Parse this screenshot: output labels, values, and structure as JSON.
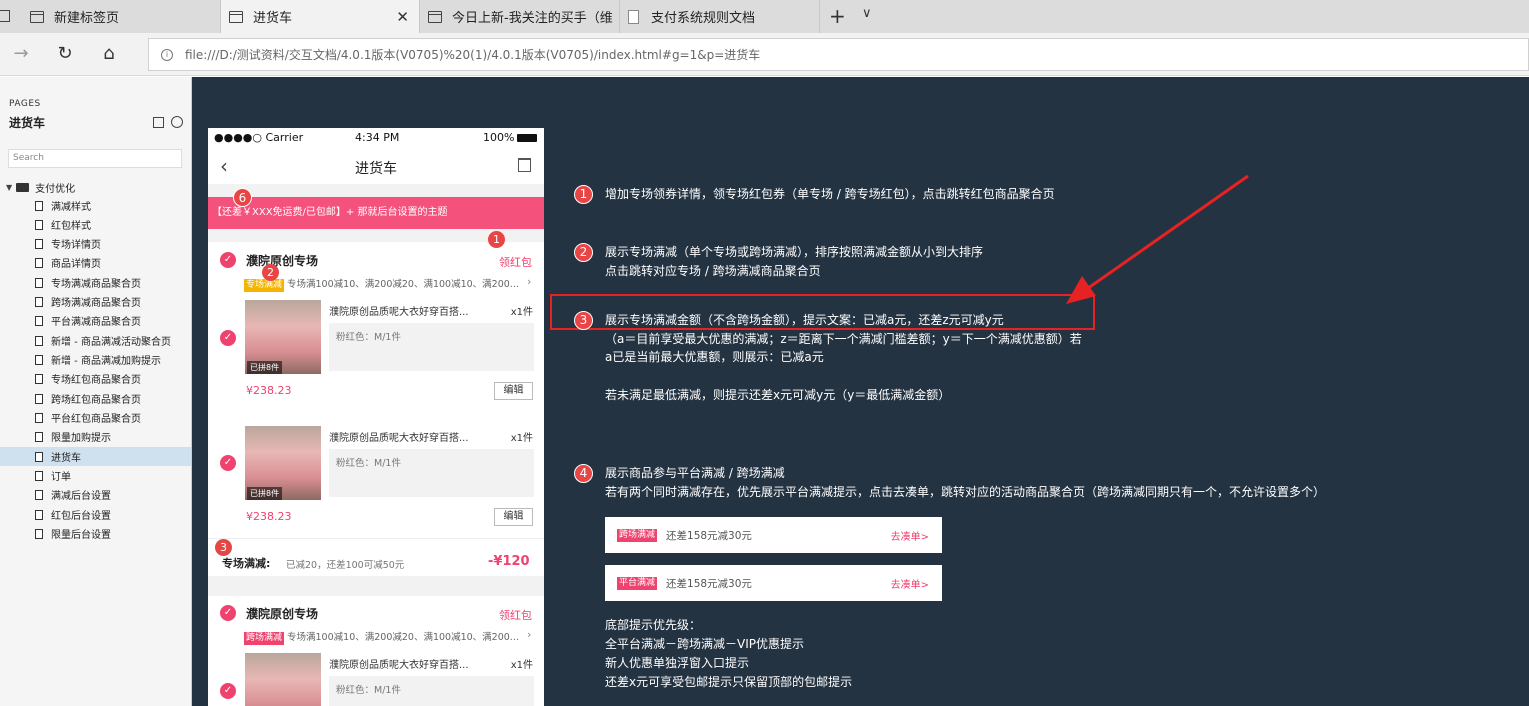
{
  "browser": {
    "tabs": [
      {
        "label": "新建标签页"
      },
      {
        "label": "进货车"
      },
      {
        "label": "今日上新-我关注的买手（维"
      },
      {
        "label": "支付系统规则文档"
      }
    ],
    "url": "file:///D:/测试资料/交互文档/4.0.1版本(V0705)%20(1)/4.0.1版本(V0705)/index.html#g=1&p=进货车"
  },
  "sidebar": {
    "pages_label": "PAGES",
    "current_page": "进货车",
    "search_placeholder": "Search",
    "folder": "支付优化",
    "items": [
      {
        "label": "满减样式"
      },
      {
        "label": "红包样式"
      },
      {
        "label": "专场详情页"
      },
      {
        "label": "商品详情页"
      },
      {
        "label": "专场满减商品聚合页"
      },
      {
        "label": "跨场满减商品聚合页"
      },
      {
        "label": "平台满减商品聚合页"
      },
      {
        "label": "新增 - 商品满减活动聚合页"
      },
      {
        "label": "新增 - 商品满减加购提示"
      },
      {
        "label": "专场红包商品聚合页"
      },
      {
        "label": "跨场红包商品聚合页"
      },
      {
        "label": "平台红包商品聚合页"
      },
      {
        "label": "限量加购提示"
      },
      {
        "label": "进货车"
      },
      {
        "label": "订单"
      },
      {
        "label": "满减后台设置"
      },
      {
        "label": "红包后台设置"
      },
      {
        "label": "限量后台设置"
      }
    ]
  },
  "phone": {
    "status": {
      "carrier": "●●●●○ Carrier",
      "time": "4:34 PM",
      "battery": "100%"
    },
    "title": "进货车",
    "banner": "【还差￥XXX免运费/已包邮】+ 那就后台设置的主题",
    "shop1": {
      "name": "濮院原创专场",
      "coupon": "领红包",
      "promo_tag": "专场满减",
      "promo": "专场满100减10、满200减20、满100减10、满200...",
      "items": [
        {
          "name": "濮院原创品质呢大衣好穿百搭...",
          "qty": "x1件",
          "spec": "粉红色：M/1件",
          "img_label": "已拼8件",
          "price": "¥238.23",
          "edit": "编辑"
        },
        {
          "name": "濮院原创品质呢大衣好穿百搭...",
          "qty": "x1件",
          "spec": "粉红色：M/1件",
          "img_label": "已拼8件",
          "price": "¥238.23",
          "edit": "编辑"
        }
      ],
      "summary_label": "专场满减:",
      "summary_text": "已减20，还差100可减50元",
      "summary_amount": "-¥120"
    },
    "shop2": {
      "name": "濮院原创专场",
      "coupon": "领红包",
      "promo_tag": "跨场满减",
      "promo": "专场满100减10、满200减20、满100减10、满200...",
      "item": {
        "name": "濮院原创品质呢大衣好穿百搭...",
        "qty": "x1件",
        "spec": "粉红色：M/1件"
      }
    },
    "badges": [
      "6",
      "1",
      "2",
      "3"
    ]
  },
  "annotations": {
    "a1": {
      "num": "1",
      "text": "增加专场领券详情，领专场红包券（单专场 / 跨专场红包），点击跳转红包商品聚合页"
    },
    "a2": {
      "num": "2",
      "line1": "展示专场满减（单个专场或跨场满减），排序按照满减金额从小到大排序",
      "line2": "点击跳转对应专场 / 跨场满减商品聚合页"
    },
    "a3": {
      "num": "3",
      "line1": "展示专场满减金额（不含跨场金额），提示文案：已减a元，还差z元可减y元",
      "line2": "（a＝目前享受最大优惠的满减；z＝距离下一个满减门槛差额；y＝下一个满减优惠额）若",
      "line3": "a已是当前最大优惠额，则展示：已减a元",
      "line4": "若未满足最低满减，则提示还差x元可减y元（y＝最低满减金额）"
    },
    "a4": {
      "num": "4",
      "line1": "展示商品参与平台满减 / 跨场满减",
      "line2": "若有两个同时满减存在，优先展示平台满减提示，点击去凑单，跳转对应的活动商品聚合页（跨场满减同期只有一个，不允许设置多个）"
    },
    "examples": [
      {
        "tag": "跨场满减",
        "text": "还差158元减30元",
        "link": "去凑单>"
      },
      {
        "tag": "平台满减",
        "text": "还差158元减30元",
        "link": "去凑单>"
      }
    ],
    "priority": {
      "title": "底部提示优先级：",
      "line1": "全平台满减－跨场满减－VIP优惠提示",
      "line2": "新人优惠单独浮窗入口提示",
      "line3": "还差x元可享受包邮提示只保留顶部的包邮提示"
    }
  },
  "colors": {
    "accent": "#f0426e",
    "canvas": "#243342",
    "badge": "#e84545",
    "tag_yellow": "#f5b400",
    "tag_red": "#f0426e"
  }
}
